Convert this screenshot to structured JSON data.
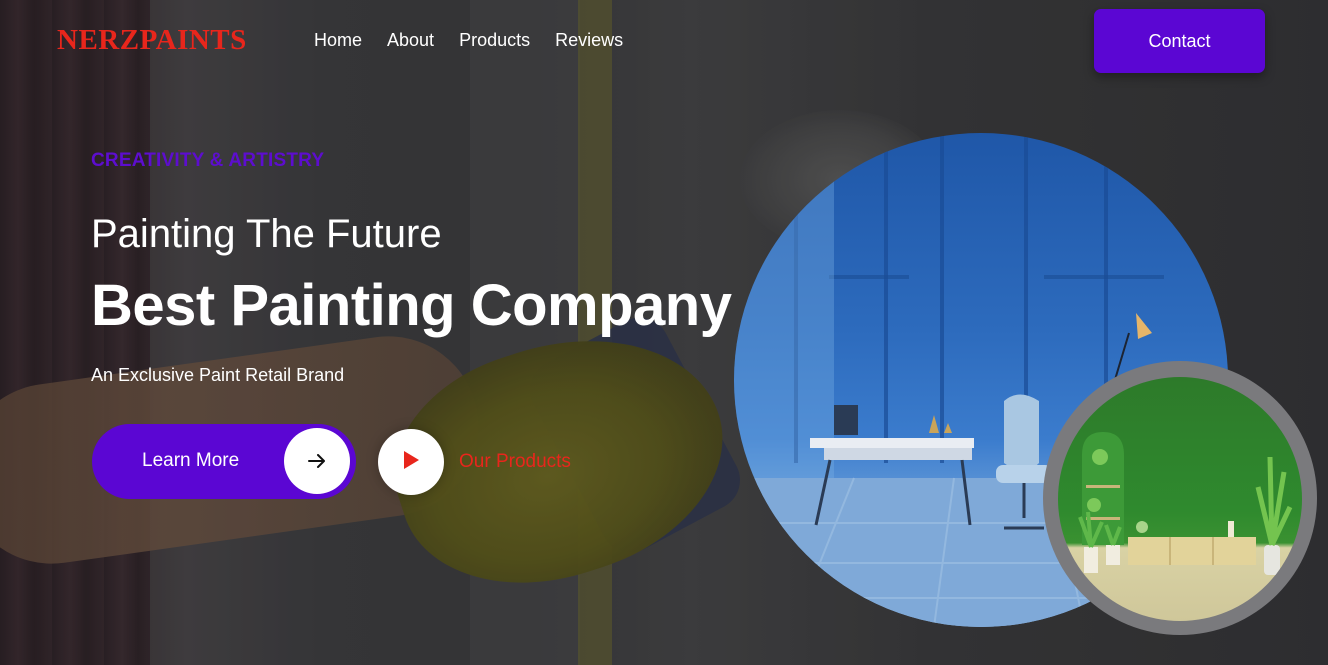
{
  "brand": {
    "logo": "NERZPAINTS",
    "logo_color": "#e8261c"
  },
  "nav": {
    "items": [
      "Home",
      "About",
      "Products",
      "Reviews"
    ],
    "contact_label": "Contact"
  },
  "hero": {
    "eyebrow": "CREATIVITY & ARTISTRY",
    "headline_1": "Painting The Future",
    "headline_2": "Best Painting Company",
    "tagline": "An Exclusive Paint Retail Brand",
    "learn_more_label": "Learn More",
    "our_products_label": "Our Products"
  },
  "icons": {
    "learn_more": "arrow-right-icon",
    "our_products": "play-icon"
  },
  "colors": {
    "accent": "#5b06d3",
    "brand_red": "#e8261c",
    "text": "#ffffff"
  }
}
